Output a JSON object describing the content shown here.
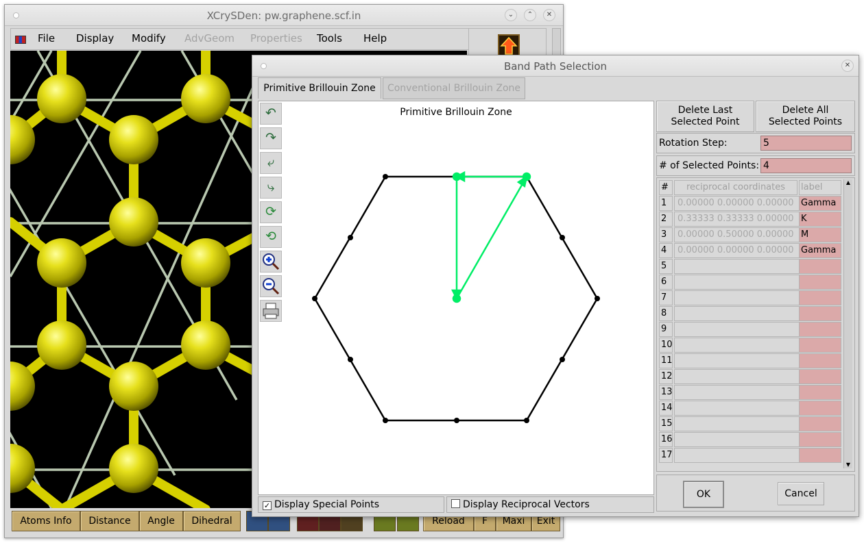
{
  "main_window": {
    "title": "XCrySDen: pw.graphene.scf.in",
    "menu": [
      {
        "label": "File",
        "enabled": true
      },
      {
        "label": "Display",
        "enabled": true
      },
      {
        "label": "Modify",
        "enabled": true
      },
      {
        "label": "AdvGeom",
        "enabled": false
      },
      {
        "label": "Properties",
        "enabled": false
      },
      {
        "label": "Tools",
        "enabled": true
      },
      {
        "label": "Help",
        "enabled": true
      }
    ],
    "bottom_buttons": [
      "Atoms Info",
      "Distance",
      "Angle",
      "Dihedral"
    ],
    "bottom_right_buttons": [
      "Reload",
      "F",
      "Maxi",
      "Exit"
    ]
  },
  "dialog": {
    "title": "Band Path Selection",
    "tabs": [
      {
        "label": "Primitive Brillouin Zone",
        "active": true
      },
      {
        "label": "Conventional Brillouin Zone",
        "active": false
      }
    ],
    "canvas_title": "Primitive Brillouin Zone",
    "delete_last_label": "Delete Last Selected Point",
    "delete_all_label": "Delete All Selected Points",
    "rotation_step_label": "Rotation Step:",
    "rotation_step_value": "5",
    "selected_points_label": "# of Selected Points:",
    "selected_points_value": "4",
    "table_headers": [
      "#",
      "reciprocal coordinates",
      "label"
    ],
    "rows": [
      {
        "n": "1",
        "coords": "0.00000  0.00000  0.00000",
        "label": "Gamma"
      },
      {
        "n": "2",
        "coords": "0.33333  0.33333  0.00000",
        "label": "K"
      },
      {
        "n": "3",
        "coords": "0.00000  0.50000  0.00000",
        "label": "M"
      },
      {
        "n": "4",
        "coords": "0.00000  0.00000  0.00000",
        "label": "Gamma"
      },
      {
        "n": "5",
        "coords": "",
        "label": ""
      },
      {
        "n": "6",
        "coords": "",
        "label": ""
      },
      {
        "n": "7",
        "coords": "",
        "label": ""
      },
      {
        "n": "8",
        "coords": "",
        "label": ""
      },
      {
        "n": "9",
        "coords": "",
        "label": ""
      },
      {
        "n": "10",
        "coords": "",
        "label": ""
      },
      {
        "n": "11",
        "coords": "",
        "label": ""
      },
      {
        "n": "12",
        "coords": "",
        "label": ""
      },
      {
        "n": "13",
        "coords": "",
        "label": ""
      },
      {
        "n": "14",
        "coords": "",
        "label": ""
      },
      {
        "n": "15",
        "coords": "",
        "label": ""
      },
      {
        "n": "16",
        "coords": "",
        "label": ""
      },
      {
        "n": "17",
        "coords": "",
        "label": ""
      }
    ],
    "display_special_points_label": "Display Special Points",
    "display_special_points_checked": true,
    "display_reciprocal_vectors_label": "Display Reciprocal Vectors",
    "display_reciprocal_vectors_checked": false,
    "ok_label": "OK",
    "cancel_label": "Cancel",
    "path_color": "#00ee66",
    "field_color": "#dba9a9"
  },
  "tools": [
    "rotate-up-icon",
    "rotate-down-icon",
    "rotate-left-icon",
    "rotate-right-icon",
    "rotate-cw-icon",
    "rotate-ccw-icon",
    "zoom-in-icon",
    "zoom-out-icon",
    "print-icon"
  ]
}
